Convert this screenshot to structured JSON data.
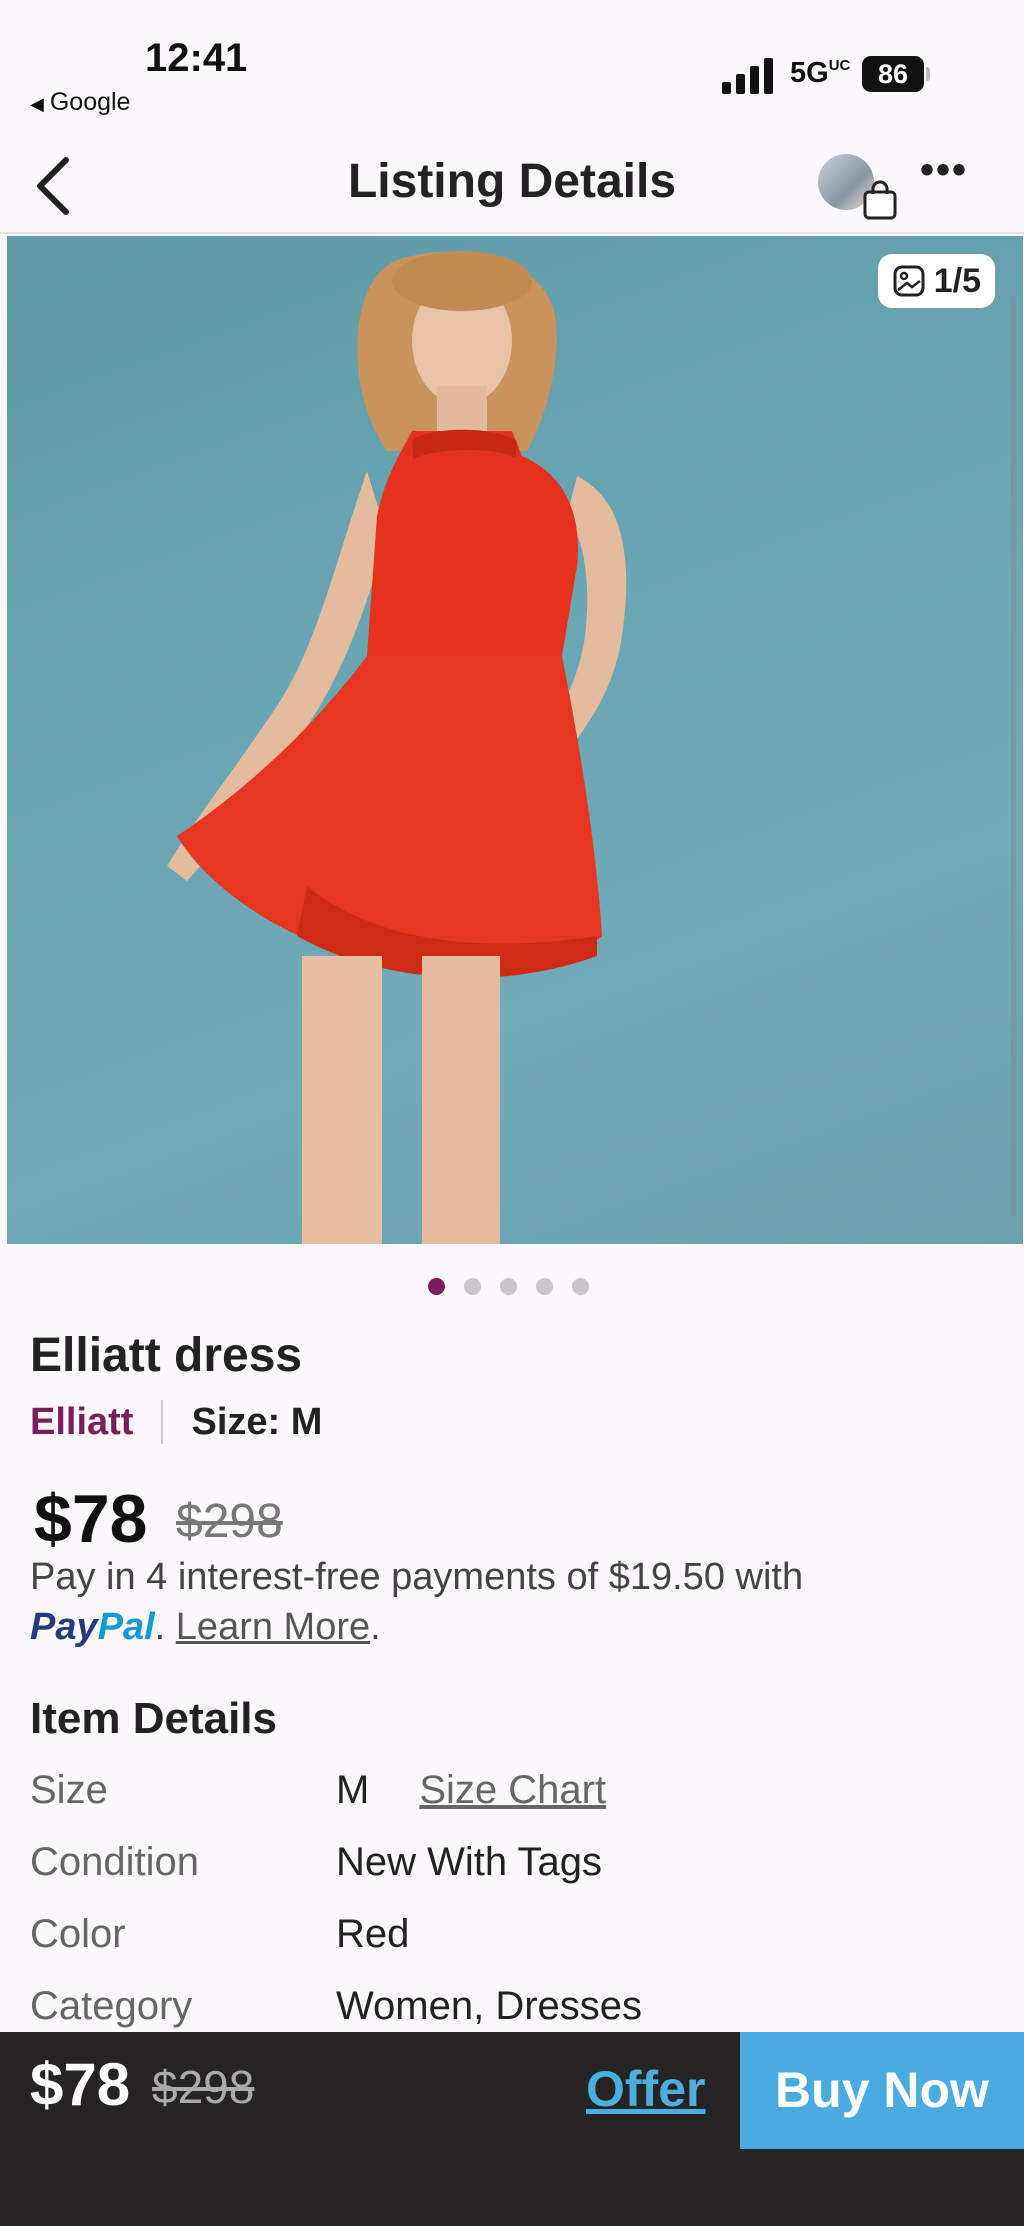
{
  "status_bar": {
    "time": "12:41",
    "back_app": "Google",
    "network": "5G",
    "network_suffix": "UC",
    "battery": "86"
  },
  "nav": {
    "title": "Listing Details"
  },
  "photo": {
    "counter": "1/5",
    "dots_total": 5,
    "active_dot": 0
  },
  "listing": {
    "title": "Elliatt dress",
    "brand": "Elliatt",
    "size_label": "Size: M",
    "price": "$78",
    "original_price": "$298",
    "pay_text": "Pay in 4 interest-free payments of $19.50 with",
    "paypal_1": "Pay",
    "paypal_2": "Pal",
    "paypal_after": ".",
    "learn_more": "Learn More",
    "learn_after": "."
  },
  "item_details": {
    "heading": "Item Details",
    "rows": [
      {
        "label": "Size",
        "value": "M",
        "link": "Size Chart"
      },
      {
        "label": "Condition",
        "value": "New With Tags"
      },
      {
        "label": "Color",
        "value": "Red"
      },
      {
        "label": "Category",
        "value": "Women, Dresses"
      }
    ]
  },
  "bottom_bar": {
    "price": "$78",
    "original_price": "$298",
    "offer": "Offer",
    "buy_now": "Buy Now"
  },
  "colors": {
    "brand": "#7a1f5c",
    "accent": "#4aabe0",
    "bar": "#262324"
  }
}
